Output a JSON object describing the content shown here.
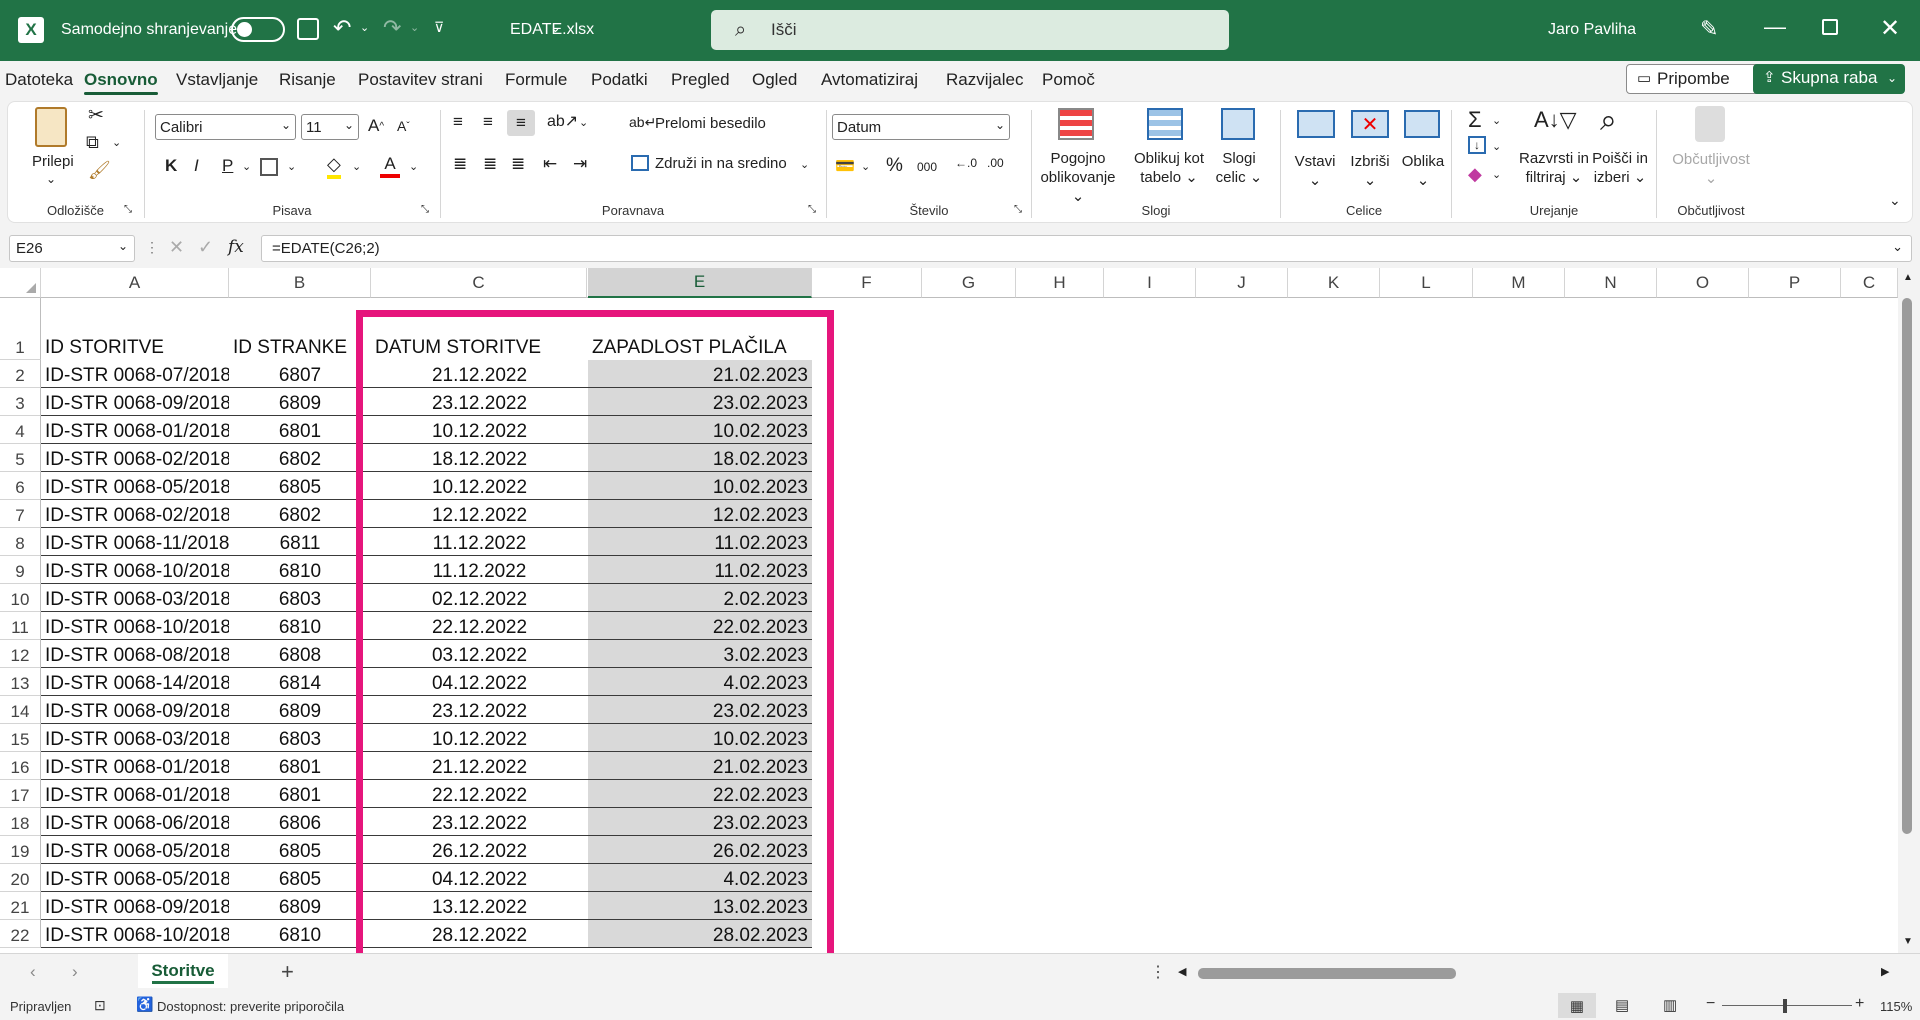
{
  "titlebar": {
    "autosave_label": "Samodejno shranjevanje",
    "filename": "EDATE.xlsx",
    "search_placeholder": "Išči",
    "user": "Jaro Pavliha"
  },
  "menu": {
    "tabs": [
      "Datoteka",
      "Osnovno",
      "Vstavljanje",
      "Risanje",
      "Postavitev strani",
      "Formule",
      "Podatki",
      "Pregled",
      "Ogled",
      "Avtomatiziraj",
      "Razvijalec",
      "Pomoč"
    ],
    "active": "Osnovno",
    "comments_label": "Pripombe",
    "share_label": "Skupna raba"
  },
  "ribbon": {
    "clipboard": {
      "paste": "Prilepi",
      "group": "Odložišče"
    },
    "font": {
      "name": "Calibri",
      "size": "11",
      "bold": "K",
      "italic": "I",
      "underline": "P",
      "group": "Pisava"
    },
    "alignment": {
      "wrap": "Prelomi besedilo",
      "merge": "Združi in na sredino",
      "group": "Poravnava"
    },
    "number": {
      "format": "Datum",
      "group": "Število"
    },
    "styles": {
      "conditional1": "Pogojno",
      "conditional2": "oblikovanje",
      "table1": "Oblikuj kot",
      "table2": "tabelo",
      "cell1": "Slogi",
      "cell2": "celic",
      "group": "Slogi"
    },
    "cells": {
      "insert": "Vstavi",
      "delete": "Izbriši",
      "format": "Oblika",
      "group": "Celice"
    },
    "editing": {
      "sort1": "Razvrsti in",
      "sort2": "filtriraj",
      "find1": "Poišči in",
      "find2": "izberi",
      "group": "Urejanje"
    },
    "sensitivity": {
      "label": "Občutljivost",
      "group": "Občutljivost"
    }
  },
  "formula_bar": {
    "name_box": "E26",
    "fx": "fx",
    "formula": "=EDATE(C26;2)"
  },
  "grid": {
    "columns": [
      "A",
      "B",
      "C",
      "",
      "E",
      "F",
      "G",
      "H",
      "I",
      "J",
      "K",
      "L",
      "M",
      "N",
      "O",
      "P",
      "C"
    ],
    "selected_column": "E",
    "headers": {
      "a": "ID STORITVE",
      "b": "ID STRANKE",
      "c": "DATUM STORITVE",
      "e": "ZAPADLOST PLAČILA"
    },
    "rows": [
      {
        "n": "2",
        "a": "ID-STR 0068-07/2018",
        "b": "6807",
        "c": "21.12.2022",
        "e": "21.02.2023"
      },
      {
        "n": "3",
        "a": "ID-STR 0068-09/2018",
        "b": "6809",
        "c": "23.12.2022",
        "e": "23.02.2023"
      },
      {
        "n": "4",
        "a": "ID-STR 0068-01/2018",
        "b": "6801",
        "c": "10.12.2022",
        "e": "10.02.2023"
      },
      {
        "n": "5",
        "a": "ID-STR 0068-02/2018",
        "b": "6802",
        "c": "18.12.2022",
        "e": "18.02.2023"
      },
      {
        "n": "6",
        "a": "ID-STR 0068-05/2018",
        "b": "6805",
        "c": "10.12.2022",
        "e": "10.02.2023"
      },
      {
        "n": "7",
        "a": "ID-STR 0068-02/2018",
        "b": "6802",
        "c": "12.12.2022",
        "e": "12.02.2023"
      },
      {
        "n": "8",
        "a": "ID-STR 0068-11/2018",
        "b": "6811",
        "c": "11.12.2022",
        "e": "11.02.2023"
      },
      {
        "n": "9",
        "a": "ID-STR 0068-10/2018",
        "b": "6810",
        "c": "11.12.2022",
        "e": "11.02.2023"
      },
      {
        "n": "10",
        "a": "ID-STR 0068-03/2018",
        "b": "6803",
        "c": "02.12.2022",
        "e": "2.02.2023"
      },
      {
        "n": "11",
        "a": "ID-STR 0068-10/2018",
        "b": "6810",
        "c": "22.12.2022",
        "e": "22.02.2023"
      },
      {
        "n": "12",
        "a": "ID-STR 0068-08/2018",
        "b": "6808",
        "c": "03.12.2022",
        "e": "3.02.2023"
      },
      {
        "n": "13",
        "a": "ID-STR 0068-14/2018",
        "b": "6814",
        "c": "04.12.2022",
        "e": "4.02.2023"
      },
      {
        "n": "14",
        "a": "ID-STR 0068-09/2018",
        "b": "6809",
        "c": "23.12.2022",
        "e": "23.02.2023"
      },
      {
        "n": "15",
        "a": "ID-STR 0068-03/2018",
        "b": "6803",
        "c": "10.12.2022",
        "e": "10.02.2023"
      },
      {
        "n": "16",
        "a": "ID-STR 0068-01/2018",
        "b": "6801",
        "c": "21.12.2022",
        "e": "21.02.2023"
      },
      {
        "n": "17",
        "a": "ID-STR 0068-01/2018",
        "b": "6801",
        "c": "22.12.2022",
        "e": "22.02.2023"
      },
      {
        "n": "18",
        "a": "ID-STR 0068-06/2018",
        "b": "6806",
        "c": "23.12.2022",
        "e": "23.02.2023"
      },
      {
        "n": "19",
        "a": "ID-STR 0068-05/2018",
        "b": "6805",
        "c": "26.12.2022",
        "e": "26.02.2023"
      },
      {
        "n": "20",
        "a": "ID-STR 0068-05/2018",
        "b": "6805",
        "c": "04.12.2022",
        "e": "4.02.2023"
      },
      {
        "n": "21",
        "a": "ID-STR 0068-09/2018",
        "b": "6809",
        "c": "13.12.2022",
        "e": "13.02.2023"
      },
      {
        "n": "22",
        "a": "ID-STR 0068-10/2018",
        "b": "6810",
        "c": "28.12.2022",
        "e": "28.02.2023"
      }
    ]
  },
  "sheets": {
    "active": "Storitve",
    "add": "+"
  },
  "status": {
    "ready": "Pripravljen",
    "accessibility": "Dostopnost: preverite priporočila",
    "zoom": "115%"
  },
  "colors": {
    "excel_green": "#217346",
    "highlight": "#e6157c",
    "selected_fill": "#d9d9d9"
  }
}
